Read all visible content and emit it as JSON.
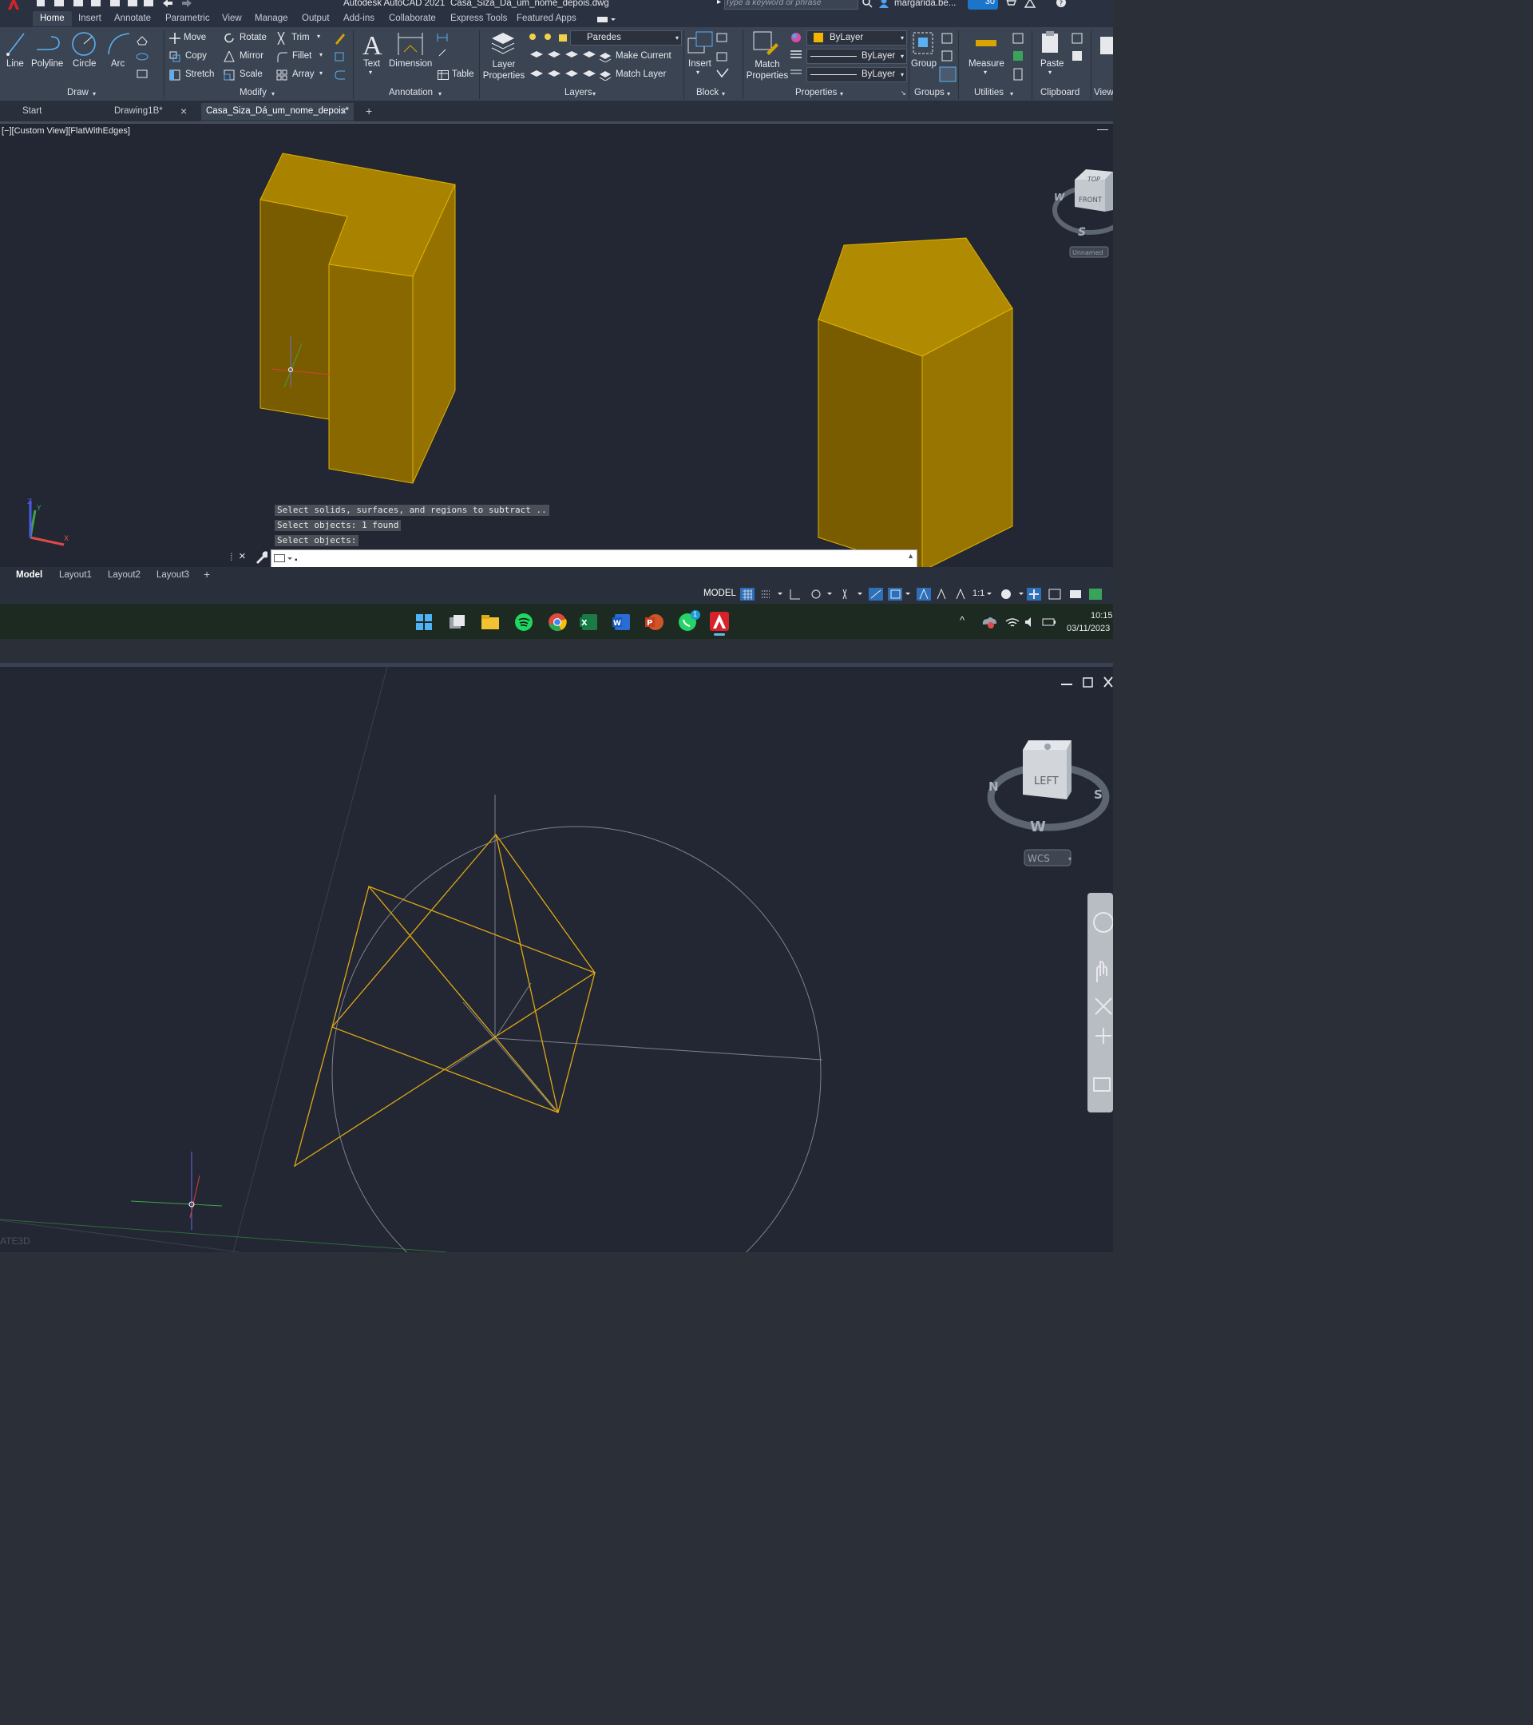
{
  "title_bar": {
    "app_title": "Autodesk AutoCAD 2021",
    "file_name": "Casa_Siza_Dá_um_nome_depois.dwg",
    "search_placeholder": "Type a keyword or phrase",
    "user": "margarida.be...",
    "badge": "30"
  },
  "ribbon_tabs": [
    "Home",
    "Insert",
    "Annotate",
    "Parametric",
    "View",
    "Manage",
    "Output",
    "Add-ins",
    "Collaborate",
    "Express Tools",
    "Featured Apps"
  ],
  "ribbon": {
    "draw": {
      "label": "Draw",
      "line": "Line",
      "polyline": "Polyline",
      "circle": "Circle",
      "arc": "Arc"
    },
    "modify": {
      "label": "Modify",
      "move": "Move",
      "rotate": "Rotate",
      "trim": "Trim",
      "copy": "Copy",
      "mirror": "Mirror",
      "fillet": "Fillet",
      "stretch": "Stretch",
      "scale": "Scale",
      "array": "Array"
    },
    "annotation": {
      "label": "Annotation",
      "text": "Text",
      "dimension": "Dimension",
      "table": "Table"
    },
    "layers": {
      "label": "Layers",
      "layer_properties": "Layer Properties",
      "current_layer": "Paredes",
      "make_current": "Make Current",
      "match_layer": "Match Layer"
    },
    "block": {
      "label": "Block",
      "insert": "Insert"
    },
    "properties": {
      "label": "Properties",
      "match_properties": "Match Properties",
      "color": "ByLayer",
      "linetype": "ByLayer",
      "lineweight": "ByLayer"
    },
    "groups": {
      "label": "Groups",
      "group": "Group"
    },
    "utilities": {
      "label": "Utilities",
      "measure": "Measure"
    },
    "clipboard": {
      "label": "Clipboard",
      "paste": "Paste"
    },
    "view": {
      "label": "View"
    }
  },
  "doc_tabs": [
    "Start",
    "Drawing1B*",
    "Casa_Siza_Dá_um_nome_depois*"
  ],
  "viewport": {
    "label": "[−][Custom View][FlatWithEdges]",
    "viewcube_top": "TOP",
    "viewcube_front": "FRONT",
    "compass_w": "W",
    "compass_s": "S",
    "ucs_name": "Unnamed",
    "ucs_x": "X",
    "ucs_y": "Y",
    "ucs_z": "Z"
  },
  "command_history": [
    "Select solids, surfaces, and regions to subtract ..",
    "Select objects: 1 found",
    "Select objects:"
  ],
  "command_input": "",
  "layout_tabs": [
    "Model",
    "Layout1",
    "Layout2",
    "Layout3"
  ],
  "statusbar": {
    "model": "MODEL",
    "scale": "1:1"
  },
  "taskbar": {
    "time": "10:15",
    "date": "03/11/2023",
    "whatsapp_badge": "1"
  },
  "bottom_viewport": {
    "viewcube_face": "LEFT",
    "compass_n": "N",
    "compass_s": "S",
    "compass_w": "W",
    "wcs": "WCS",
    "command_fragment": "ATE3D"
  },
  "colors": {
    "accent": "#c9a000",
    "solid_top": "#b08a00",
    "solid_left": "#7a5c00",
    "solid_right": "#987500",
    "ribbon": "#3b4453",
    "viewport": "#222733",
    "wire": "#e0a812"
  }
}
